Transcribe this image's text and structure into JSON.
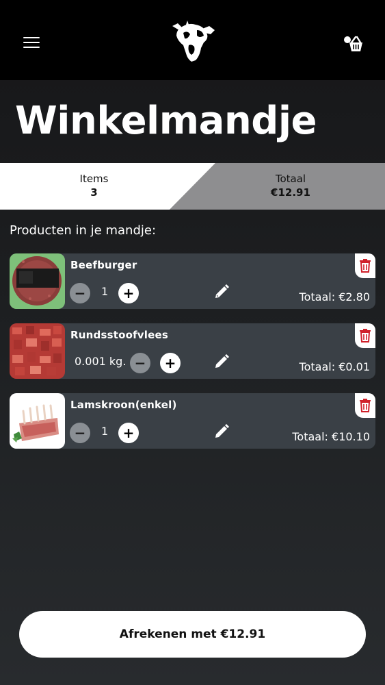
{
  "page": {
    "title": "Winkelmandje",
    "section_label": "Producten in je mandje:"
  },
  "summary": {
    "items_label": "Items",
    "items_value": "3",
    "total_label": "Totaal",
    "total_value": "€12.91"
  },
  "cart_items": [
    {
      "name": "Beefburger",
      "quantity": "1",
      "total": "Totaal: €2.80"
    },
    {
      "name": "Rundsstoofvlees",
      "quantity": "0.001 kg.",
      "total": "Totaal: €0.01"
    },
    {
      "name": "Lamskroon(enkel)",
      "quantity": "1",
      "total": "Totaal: €10.10"
    }
  ],
  "checkout": {
    "label": "Afrekenen met €12.91"
  },
  "icons": {
    "menu": "hamburger-menu-icon",
    "logo": "cow-logo",
    "basket": "basket-icon",
    "trash": "trash-icon",
    "edit": "pencil-icon",
    "minus": "minus-icon",
    "plus": "plus-icon"
  },
  "colors": {
    "background": "#1d1f21",
    "card": "#3a4046",
    "trash_red": "#d0212b",
    "summary_left": "#ffffff",
    "summary_right": "#8e8e90"
  }
}
